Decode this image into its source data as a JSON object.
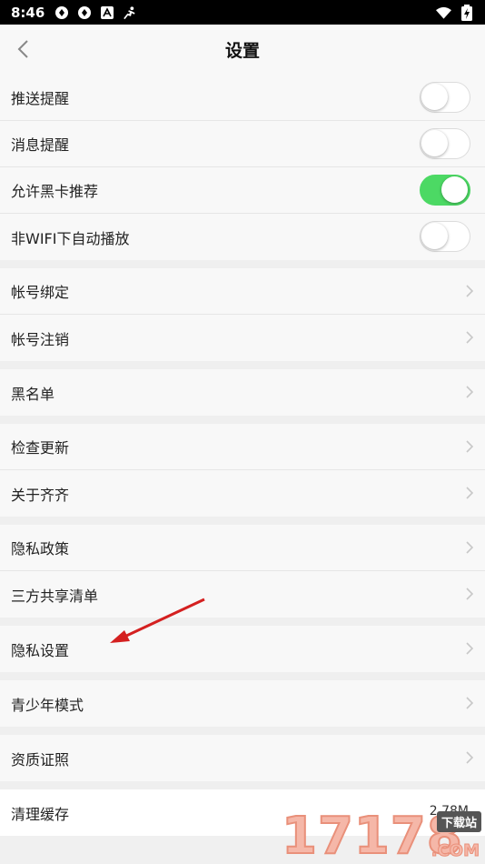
{
  "status_bar": {
    "time": "8:46",
    "left_icons": [
      "sync-icon",
      "sync-icon",
      "a-icon",
      "run-icon"
    ],
    "right_icons": [
      "wifi-icon",
      "battery-icon"
    ]
  },
  "nav": {
    "title": "设置",
    "back_icon": "chevron-left-icon"
  },
  "toggles": [
    {
      "label": "推送提醒",
      "on": false
    },
    {
      "label": "消息提醒",
      "on": false
    },
    {
      "label": "允许黑卡推荐",
      "on": true
    },
    {
      "label": "非WIFI下自动播放",
      "on": false
    }
  ],
  "groups": [
    [
      "帐号绑定",
      "帐号注销"
    ],
    [
      "黑名单"
    ],
    [
      "检查更新",
      "关于齐齐"
    ],
    [
      "隐私政策",
      "三方共享清单"
    ],
    [
      "隐私设置"
    ],
    [
      "青少年模式"
    ],
    [
      "资质证照"
    ]
  ],
  "cache": {
    "label": "清理缓存",
    "value": "2.78M"
  },
  "watermark": {
    "text": "17178",
    "tag": "下载站",
    "suffix": ".COM"
  },
  "colors": {
    "toggle_on": "#4cd964",
    "arrow": "#d42020"
  }
}
